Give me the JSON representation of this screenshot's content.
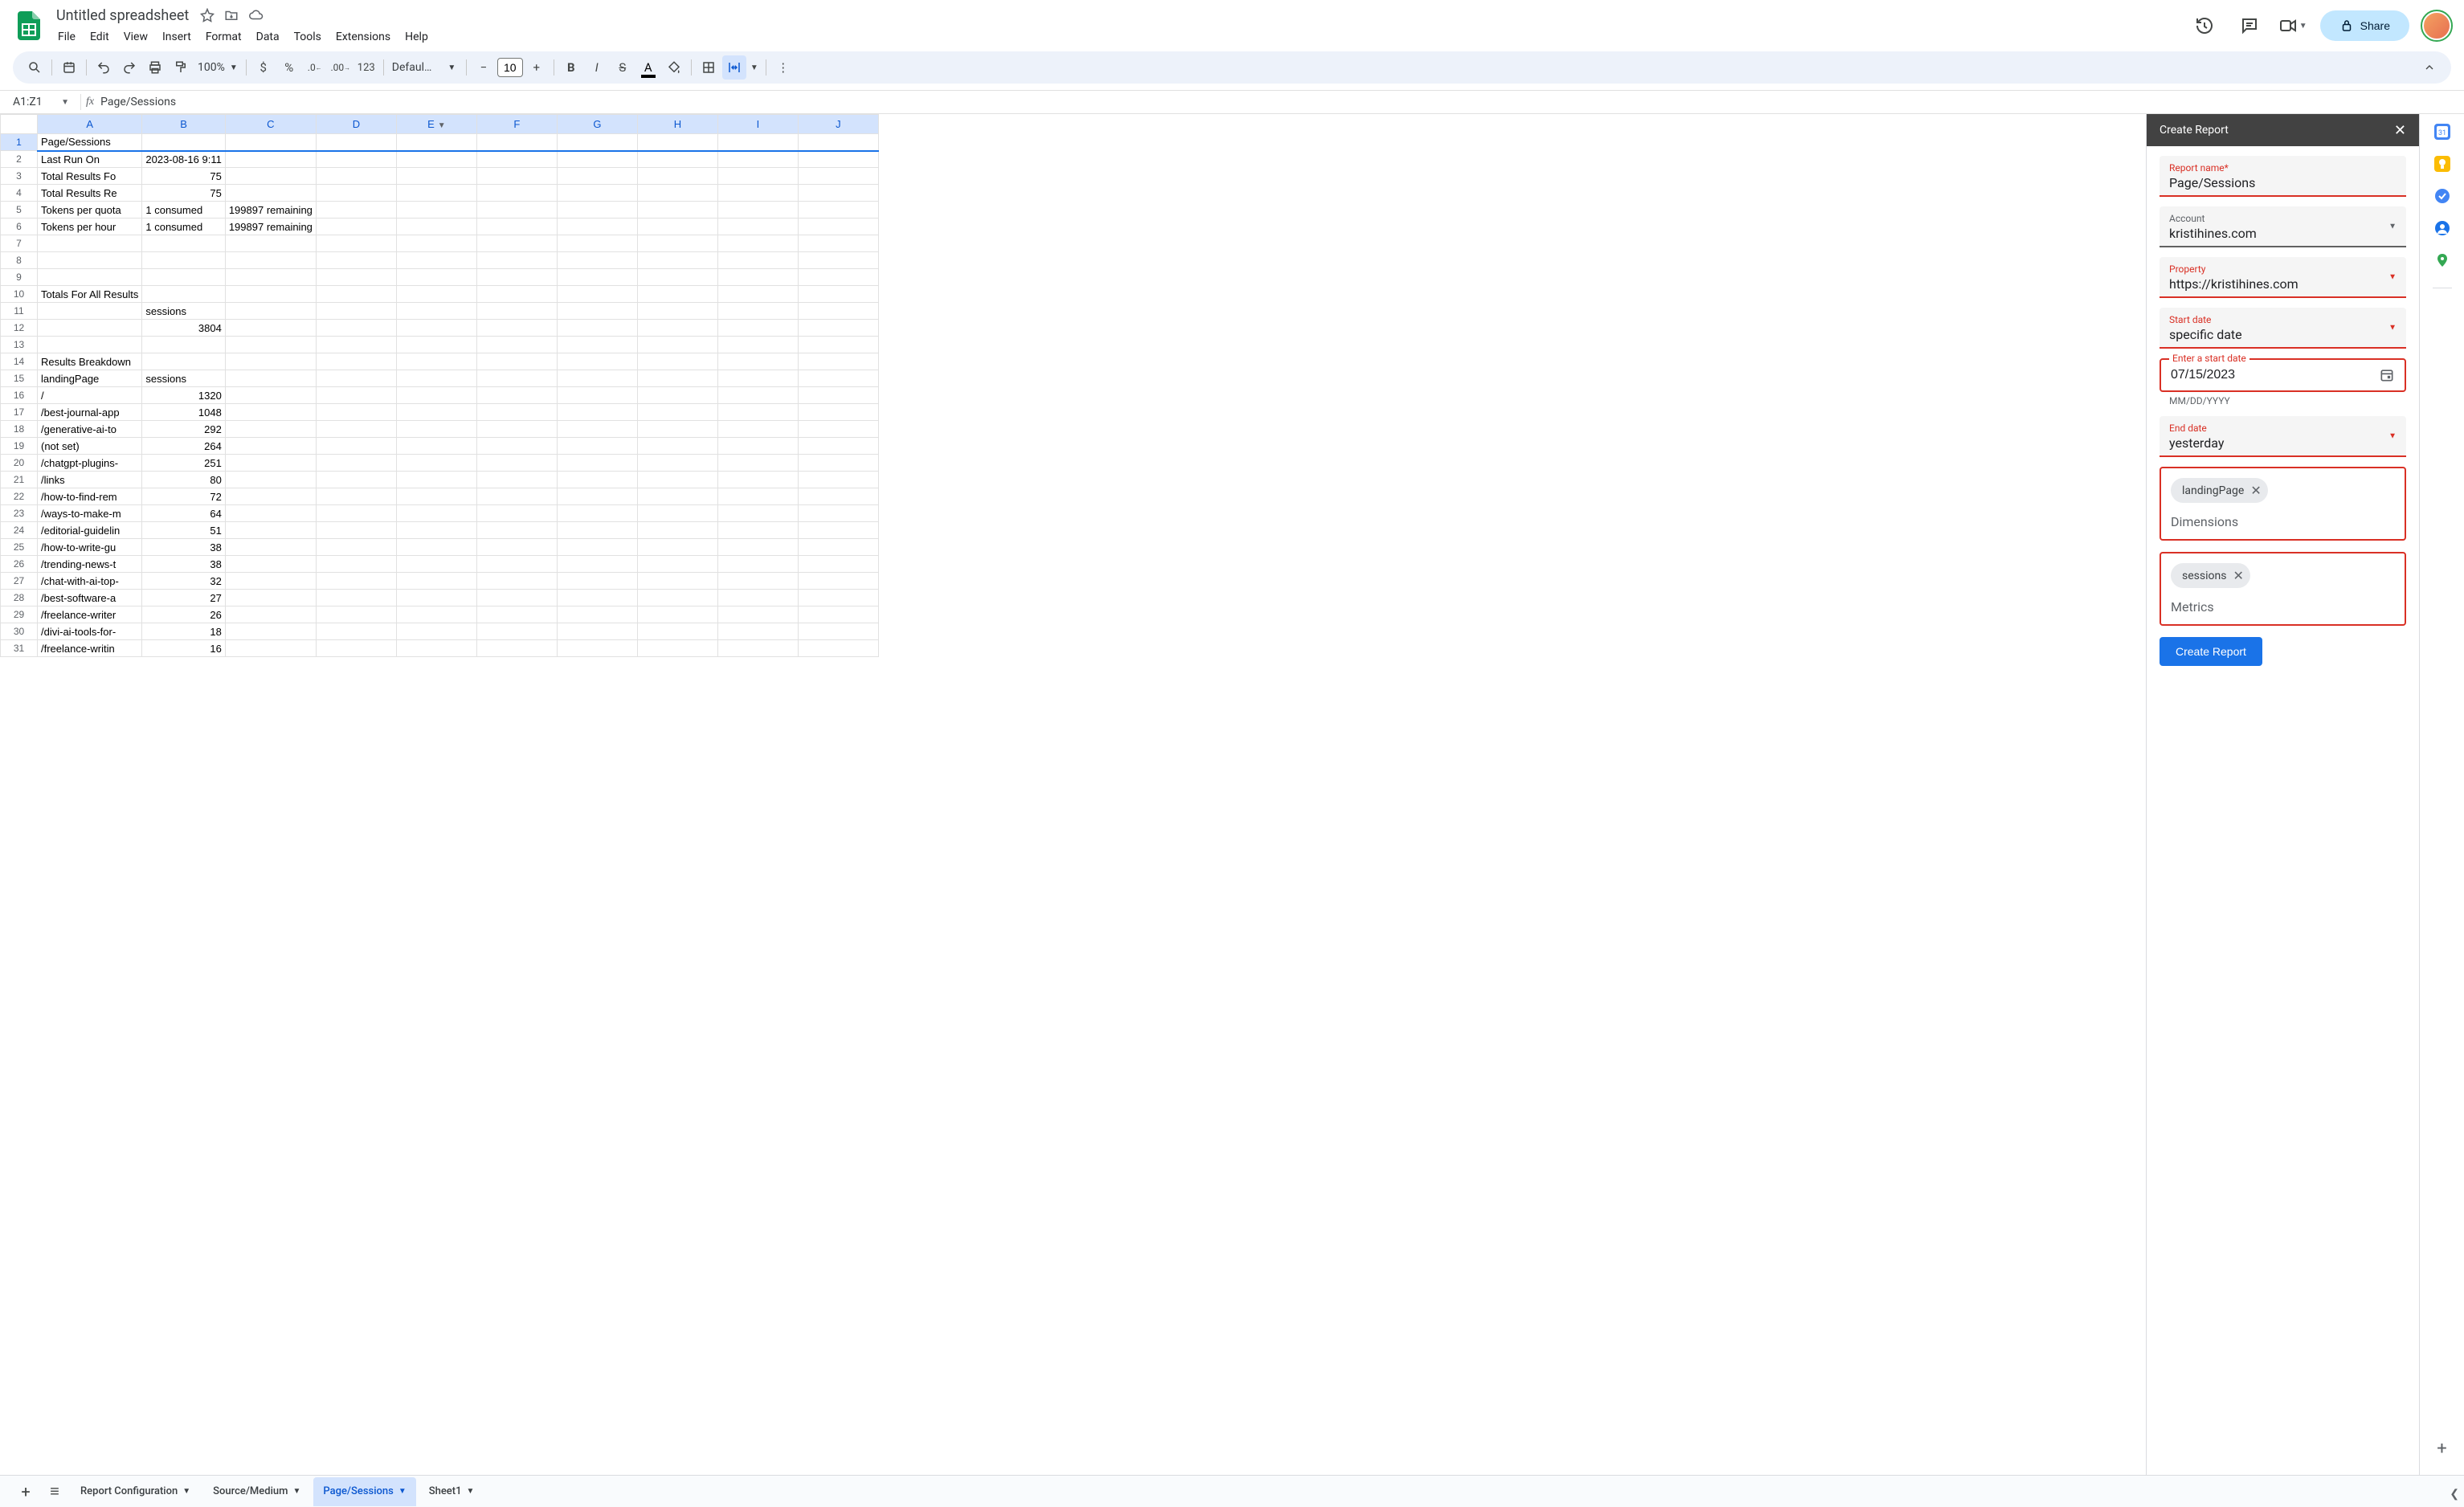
{
  "header": {
    "title": "Untitled spreadsheet",
    "menus": [
      "File",
      "Edit",
      "View",
      "Insert",
      "Format",
      "Data",
      "Tools",
      "Extensions",
      "Help"
    ],
    "share": "Share"
  },
  "toolbar": {
    "zoom": "100%",
    "font": "Defaul…",
    "fontSize": "10",
    "numfmt": "123"
  },
  "formula": {
    "nameBox": "A1:Z1",
    "value": "Page/Sessions"
  },
  "columns": [
    "A",
    "B",
    "C",
    "D",
    "E",
    "F",
    "G",
    "H",
    "I",
    "J"
  ],
  "rows": [
    {
      "n": 1,
      "A": "Page/Sessions"
    },
    {
      "n": 2,
      "A": "Last Run On",
      "B": "2023-08-16 9:11"
    },
    {
      "n": 3,
      "A": "Total Results Fo",
      "B": "75",
      "Bnum": true
    },
    {
      "n": 4,
      "A": "Total Results Re",
      "B": "75",
      "Bnum": true
    },
    {
      "n": 5,
      "A": "Tokens per quota",
      "B": "1 consumed",
      "C": "199897 remaining"
    },
    {
      "n": 6,
      "A": "Tokens per hour",
      "B": "1 consumed",
      "C": "199897 remaining"
    },
    {
      "n": 7
    },
    {
      "n": 8
    },
    {
      "n": 9
    },
    {
      "n": 10,
      "A": "Totals For All Results"
    },
    {
      "n": 11,
      "B": "sessions"
    },
    {
      "n": 12,
      "B": "3804",
      "Bnum": true
    },
    {
      "n": 13
    },
    {
      "n": 14,
      "A": "Results Breakdown"
    },
    {
      "n": 15,
      "A": "landingPage",
      "B": "sessions"
    },
    {
      "n": 16,
      "A": "/",
      "B": "1320",
      "Bnum": true
    },
    {
      "n": 17,
      "A": "/best-journal-app",
      "B": "1048",
      "Bnum": true
    },
    {
      "n": 18,
      "A": "/generative-ai-to",
      "B": "292",
      "Bnum": true
    },
    {
      "n": 19,
      "A": "(not set)",
      "B": "264",
      "Bnum": true
    },
    {
      "n": 20,
      "A": "/chatgpt-plugins-",
      "B": "251",
      "Bnum": true
    },
    {
      "n": 21,
      "A": "/links",
      "B": "80",
      "Bnum": true
    },
    {
      "n": 22,
      "A": "/how-to-find-rem",
      "B": "72",
      "Bnum": true
    },
    {
      "n": 23,
      "A": "/ways-to-make-m",
      "B": "64",
      "Bnum": true
    },
    {
      "n": 24,
      "A": "/editorial-guidelin",
      "B": "51",
      "Bnum": true
    },
    {
      "n": 25,
      "A": "/how-to-write-gu",
      "B": "38",
      "Bnum": true
    },
    {
      "n": 26,
      "A": "/trending-news-t",
      "B": "38",
      "Bnum": true
    },
    {
      "n": 27,
      "A": "/chat-with-ai-top-",
      "B": "32",
      "Bnum": true
    },
    {
      "n": 28,
      "A": "/best-software-a",
      "B": "27",
      "Bnum": true
    },
    {
      "n": 29,
      "A": "/freelance-writer",
      "B": "26",
      "Bnum": true
    },
    {
      "n": 30,
      "A": "/divi-ai-tools-for-",
      "B": "18",
      "Bnum": true
    },
    {
      "n": 31,
      "A": "/freelance-writin",
      "B": "16",
      "Bnum": true
    }
  ],
  "sidebar": {
    "title": "Create Report",
    "reportNameLabel": "Report name*",
    "reportName": "Page/Sessions",
    "accountLabel": "Account",
    "account": "kristihines.com",
    "propertyLabel": "Property",
    "property": "https://kristihines.com",
    "startDateLabel": "Start date",
    "startDate": "specific date",
    "enterStartLabel": "Enter a start date",
    "enterStart": "07/15/2023",
    "dateHint": "MM/DD/YYYY",
    "endDateLabel": "End date",
    "endDate": "yesterday",
    "dimChip": "landingPage",
    "dimLabel": "Dimensions",
    "metChip": "sessions",
    "metLabel": "Metrics",
    "createBtn": "Create Report"
  },
  "sheets": {
    "tabs": [
      {
        "label": "Report Configuration",
        "active": false
      },
      {
        "label": "Source/Medium",
        "active": false
      },
      {
        "label": "Page/Sessions",
        "active": true
      },
      {
        "label": "Sheet1",
        "active": false
      }
    ]
  }
}
